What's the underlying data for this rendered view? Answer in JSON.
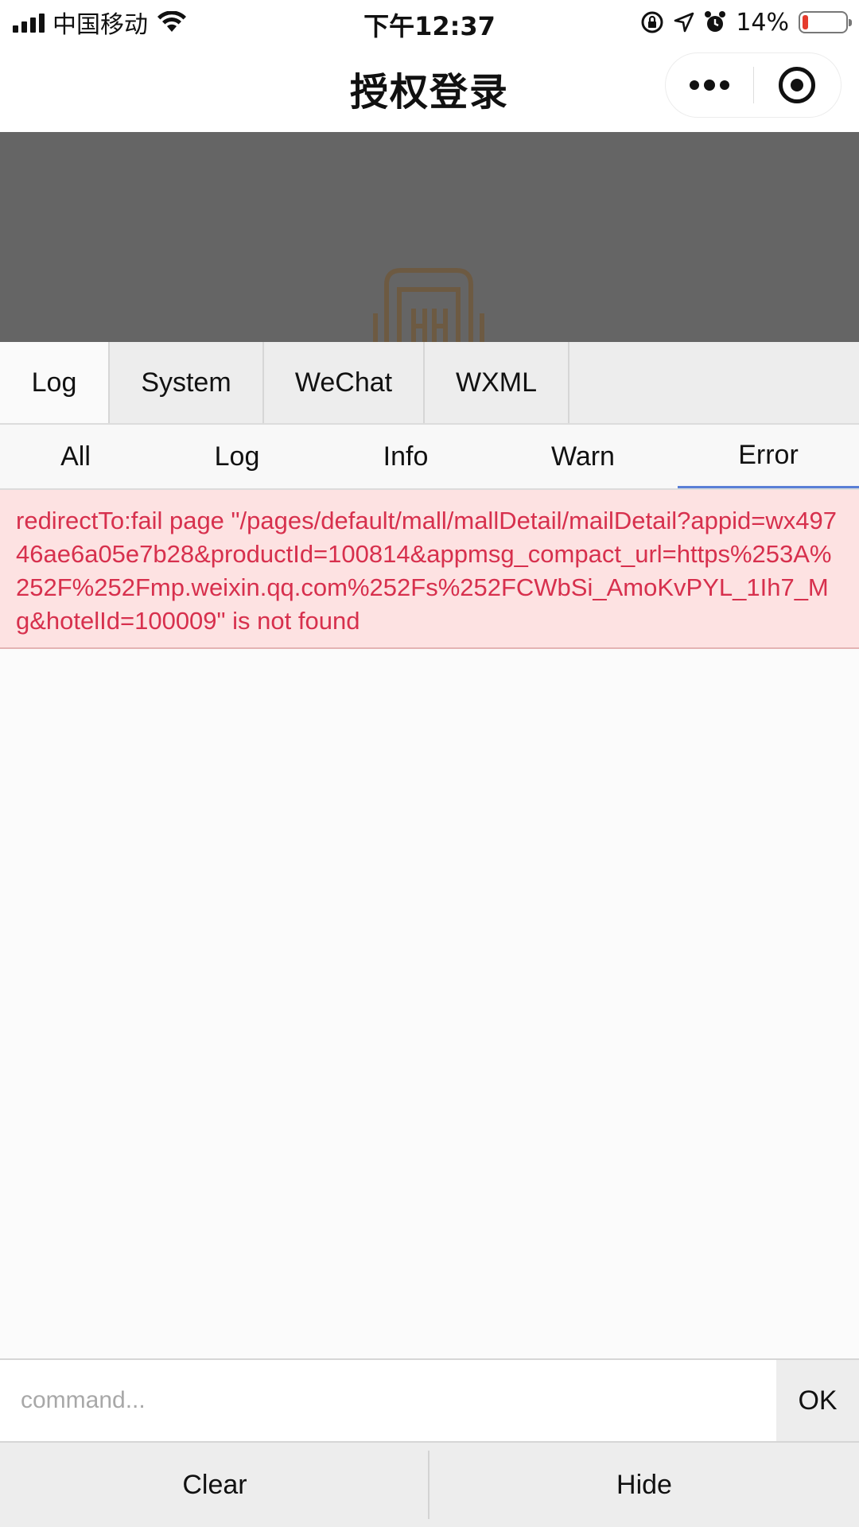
{
  "status_bar": {
    "carrier": "中国移动",
    "time": "下午12:37",
    "battery_percent": "14%",
    "battery_level": 0.14,
    "battery_color": "#e53a2c",
    "icons": [
      "signal-icon",
      "wifi-icon",
      "orientation-lock-icon",
      "location-icon",
      "alarm-icon",
      "battery-icon"
    ]
  },
  "nav": {
    "title": "授权登录",
    "more_icon": "more-dots-icon",
    "close_icon": "close-miniprogram-icon"
  },
  "console": {
    "main_tabs": [
      {
        "label": "Log",
        "active": true
      },
      {
        "label": "System",
        "active": false
      },
      {
        "label": "WeChat",
        "active": false
      },
      {
        "label": "WXML",
        "active": false
      }
    ],
    "sub_tabs": [
      {
        "label": "All",
        "active": false
      },
      {
        "label": "Log",
        "active": false
      },
      {
        "label": "Info",
        "active": false
      },
      {
        "label": "Warn",
        "active": false
      },
      {
        "label": "Error",
        "active": true
      }
    ],
    "active_tab_color": "#5a7fd6",
    "error_color": "#d7304d",
    "entries": [
      {
        "level": "error",
        "text": "redirectTo:fail page \"/pages/default/mall/mallDetail/mailDetail?appid=wx49746ae6a05e7b28&productId=100814&appmsg_compact_url=https%253A%252F%252Fmp.weixin.qq.com%252Fs%252FCWbSi_AmoKvPYL_1Ih7_Mg&hotelId=100009\" is not found"
      }
    ],
    "command": {
      "placeholder": "command...",
      "value": "",
      "ok_label": "OK"
    },
    "bottom": {
      "clear_label": "Clear",
      "hide_label": "Hide"
    }
  }
}
